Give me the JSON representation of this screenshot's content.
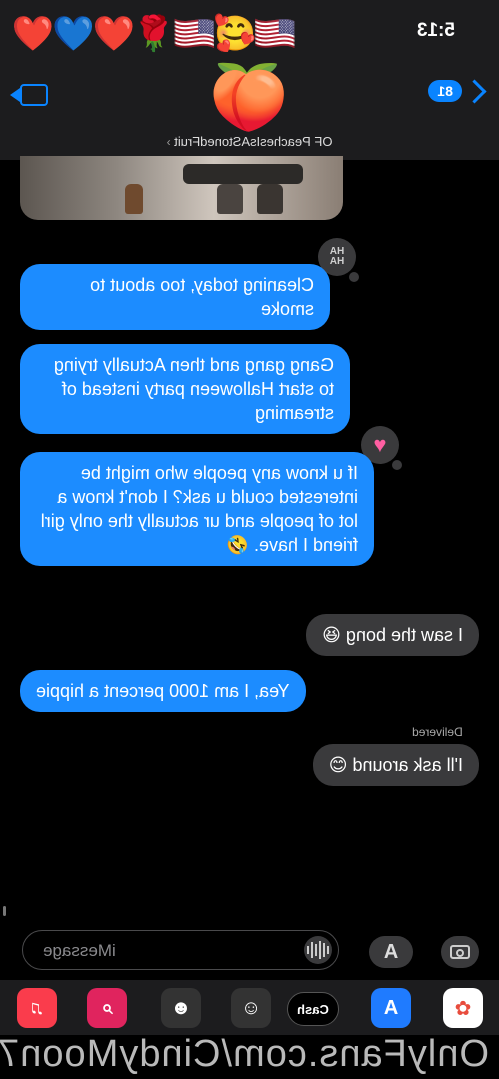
{
  "status": {
    "time": "5:13",
    "emojis": "🇺🇸🥰🇺🇸🌹❤️💙❤️"
  },
  "header": {
    "back_badge": "81",
    "avatar_emoji": "🍑",
    "contact_name": "OF PeachesIsAStonedFruit",
    "contact_chevron": "›"
  },
  "thread": {
    "tapback_haha": "HA\nHA",
    "tapback_heart": "♥",
    "messages": [
      {
        "from": "them",
        "text": "Cleaning today, too about to smoke"
      },
      {
        "from": "them",
        "text": "Gang gang and then Actually trying to start Halloween party instead of streaming"
      },
      {
        "from": "them",
        "text": "If u know any people who might be interested could u ask? I don't know a lot of people and ur actually the only girl friend I have. 🤣"
      },
      {
        "from": "me",
        "text": "I saw the bong 😆"
      },
      {
        "from": "them",
        "text": "Yea, I am 1000 percent a hippie"
      },
      {
        "from": "me",
        "text": "I'll ask around 😊"
      }
    ],
    "delivered": "Delivered"
  },
  "compose": {
    "placeholder": "iMessage",
    "apps_glyph": "A"
  },
  "drawer": {
    "apps": [
      "Photos",
      "App Store",
      "Cash",
      "Memoji",
      "Memoji Stickers",
      "Web Images",
      "Music"
    ],
    "cash_label": "Cash"
  },
  "watermark": "OnlyFans.com/CindyMoon7",
  "colors": {
    "received_bubble": "#1c8cff",
    "sent_bubble": "#3a3a3c",
    "accent": "#0a84ff"
  }
}
